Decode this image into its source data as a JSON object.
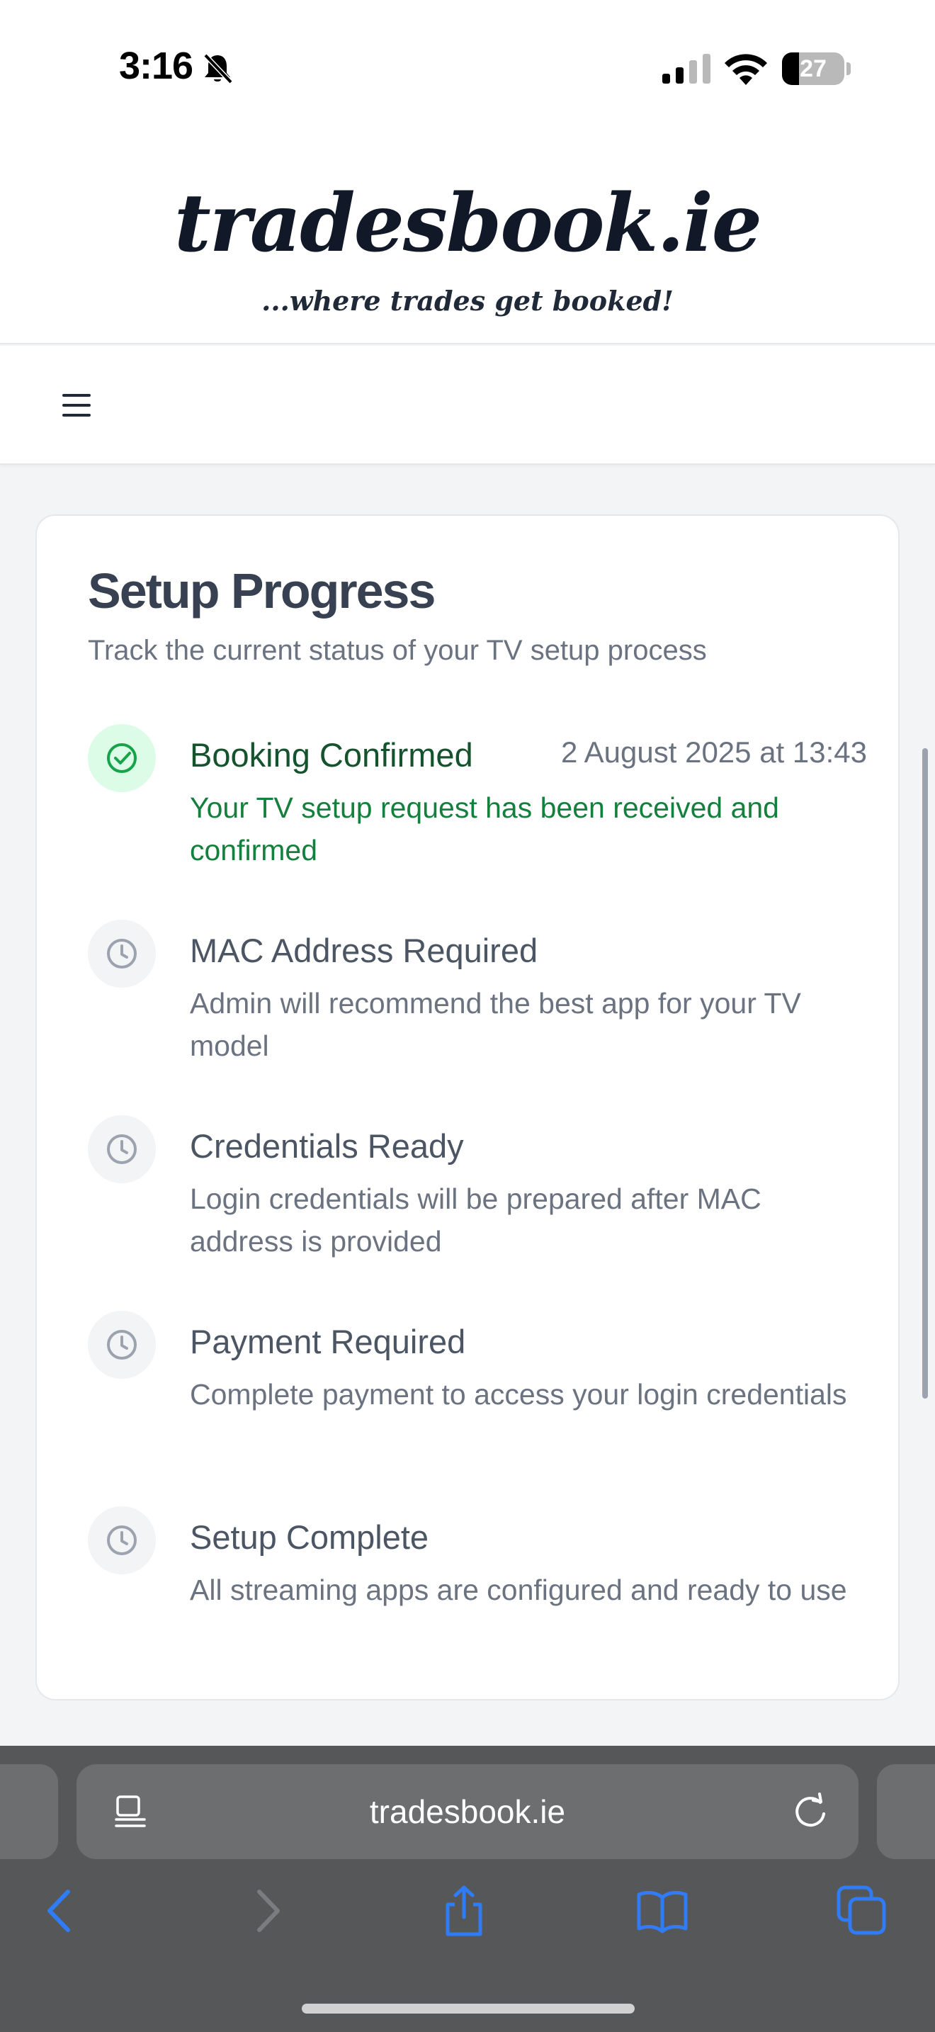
{
  "status_bar": {
    "time": "3:16",
    "battery_percent": 27,
    "battery_label": "27",
    "icons": [
      "bell-slash-icon",
      "cellular-signal-icon",
      "wifi-icon",
      "battery-icon"
    ]
  },
  "brand": {
    "logo": "tradesbook.ie",
    "tagline": "...where trades get booked!"
  },
  "nav": {
    "menu_icon": "hamburger-menu-icon"
  },
  "setup": {
    "title": "Setup Progress",
    "subtitle": "Track the current status of your TV setup process",
    "steps": [
      {
        "title": "Booking Confirmed",
        "date": "2 August 2025 at 13:43",
        "description": "Your TV setup request has been received and confirmed",
        "status": "complete",
        "icon": "check-circle-icon"
      },
      {
        "title": "MAC Address Required",
        "description": "Admin will recommend the best app for your TV model",
        "status": "pending",
        "icon": "clock-icon"
      },
      {
        "title": "Credentials Ready",
        "description": "Login credentials will be prepared after MAC address is provided",
        "status": "pending",
        "icon": "clock-icon"
      },
      {
        "title": "Payment Required",
        "description": "Complete payment to access your login credentials",
        "status": "pending",
        "icon": "clock-icon"
      },
      {
        "title": "Setup Complete",
        "description": "All streaming apps are configured and ready to use",
        "status": "pending",
        "icon": "clock-icon"
      }
    ]
  },
  "browser": {
    "url": "tradesbook.ie",
    "icons": [
      "reader-icon",
      "reload-icon",
      "back-icon",
      "forward-icon",
      "share-icon",
      "bookmarks-icon",
      "tabs-icon"
    ]
  },
  "colors": {
    "complete_green": "#15803d",
    "complete_bg": "#dcfce7",
    "pending_gray": "#9ca3af",
    "toolbar_blue": "#2f7cf6"
  }
}
